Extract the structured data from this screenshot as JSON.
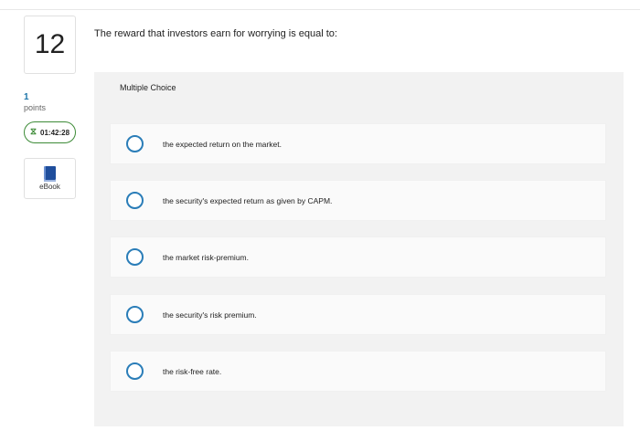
{
  "question": {
    "number": "12",
    "points_value": "1",
    "points_label": "points",
    "timer": "01:42:28",
    "ebook_label": "eBook",
    "prompt": "The reward that investors earn for worrying is equal to:"
  },
  "choices": {
    "label": "Multiple Choice",
    "options": [
      "the expected return on the market.",
      "the security's expected return as given by CAPM.",
      "the market risk-premium.",
      "the security's risk premium.",
      "the risk-free rate."
    ]
  },
  "icons": {
    "timer": "hourglass-icon",
    "ebook": "book-icon",
    "option": "radio-button-icon"
  },
  "colors": {
    "accent": "#2a7db8",
    "timer_border": "#3d8b37",
    "panel_bg": "#f2f2f2"
  }
}
